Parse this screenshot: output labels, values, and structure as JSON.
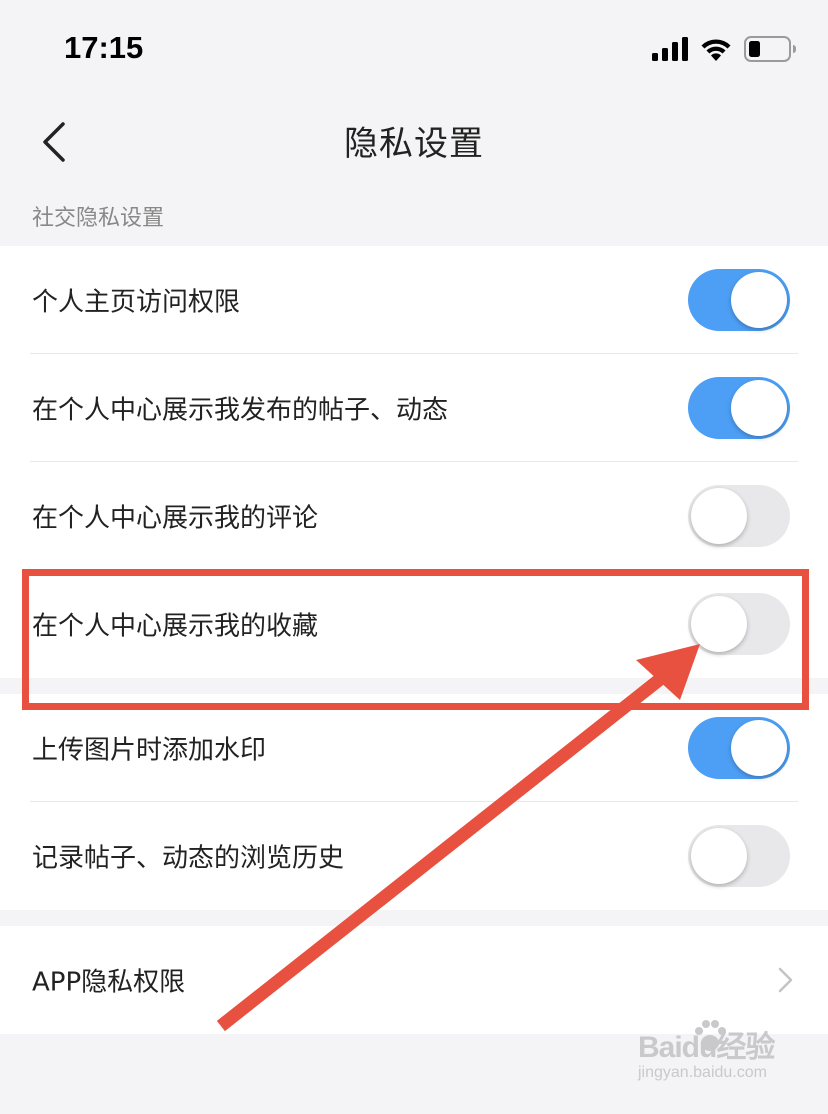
{
  "status_bar": {
    "time": "17:15",
    "icons": [
      "cellular-signal-icon",
      "wifi-icon",
      "battery-icon"
    ]
  },
  "nav": {
    "title": "隐私设置",
    "back_icon": "chevron-left-icon"
  },
  "section": {
    "header": "社交隐私设置"
  },
  "groups": [
    {
      "rows": [
        {
          "label": "个人主页访问权限",
          "toggle": true
        },
        {
          "label": "在个人中心展示我发布的帖子、动态",
          "toggle": true
        },
        {
          "label": "在个人中心展示我的评论",
          "toggle": false
        },
        {
          "label": "在个人中心展示我的收藏",
          "toggle": false
        }
      ]
    },
    {
      "rows": [
        {
          "label": "上传图片时添加水印",
          "toggle": true
        },
        {
          "label": "记录帖子、动态的浏览历史",
          "toggle": false
        }
      ]
    },
    {
      "rows": [
        {
          "label": "APP隐私权限",
          "chevron": true
        }
      ]
    }
  ],
  "watermark": {
    "brand": "Baidu经验",
    "url": "jingyan.baidu.com"
  },
  "colors": {
    "toggle_on": "#4d9ff5",
    "toggle_off": "#e8e8ea",
    "annotation": "#e8503f",
    "background": "#f4f4f6"
  }
}
